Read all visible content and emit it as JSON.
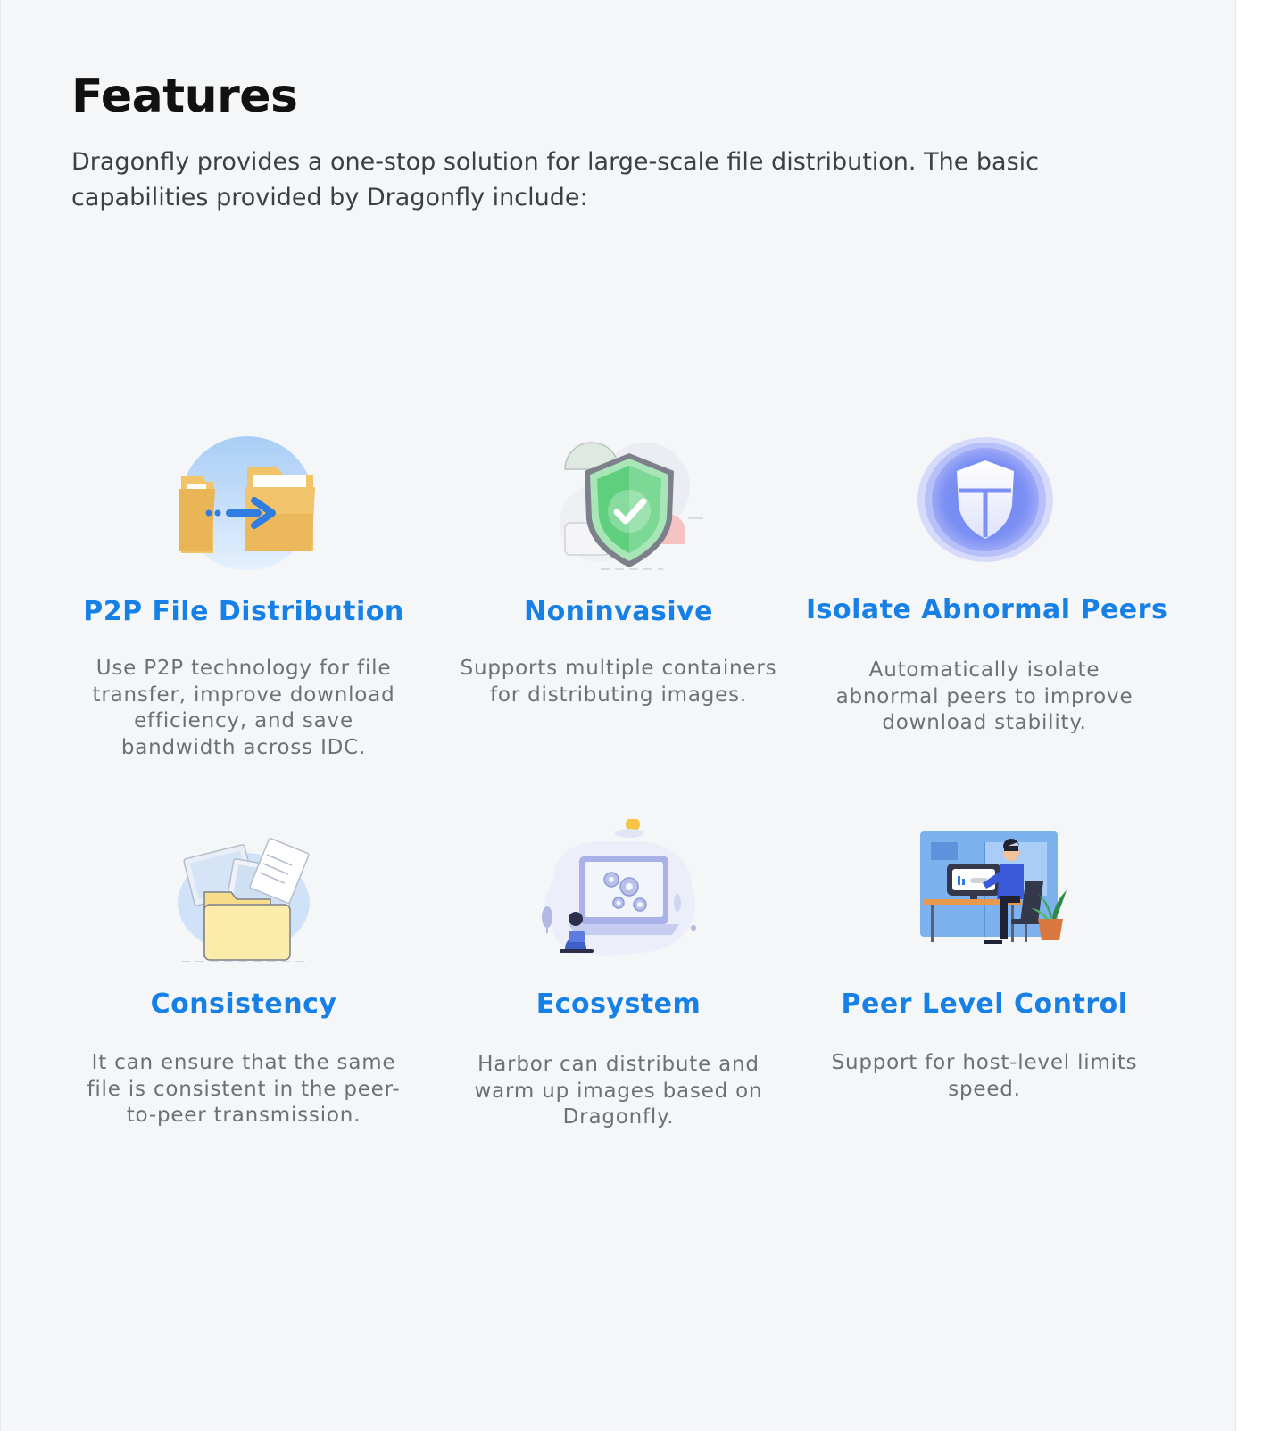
{
  "section": {
    "title": "Features",
    "intro": "Dragonfly provides a one-stop solution for large-scale file distribution. The basic capabilities provided by Dragonfly include:"
  },
  "features": [
    {
      "title": "P2P File Distribution",
      "description": "Use P2P technology for file transfer, improve download efficiency, and save bandwidth across IDC.",
      "icon": "folder-transfer-icon"
    },
    {
      "title": "Noninvasive",
      "description": "Supports multiple containers for distributing images.",
      "icon": "shield-check-icon"
    },
    {
      "title": "Isolate Abnormal Peers",
      "description": "Automatically isolate abnormal peers to improve download stability.",
      "icon": "isolation-shield-icon"
    },
    {
      "title": "Consistency",
      "description": "It can ensure that the same file is consistent in the peer-to-peer transmission.",
      "icon": "folder-documents-icon"
    },
    {
      "title": "Ecosystem",
      "description": "Harbor can distribute and warm up images based on Dragonfly.",
      "icon": "laptop-gears-icon"
    },
    {
      "title": "Peer Level Control",
      "description": "Support for host-level limits speed.",
      "icon": "person-at-desk-icon"
    }
  ],
  "colors": {
    "background": "#f5f6f8",
    "title": "#111111",
    "intro_text": "#3c3f44",
    "feature_title": "#1680e6",
    "feature_desc": "#6d7075"
  }
}
